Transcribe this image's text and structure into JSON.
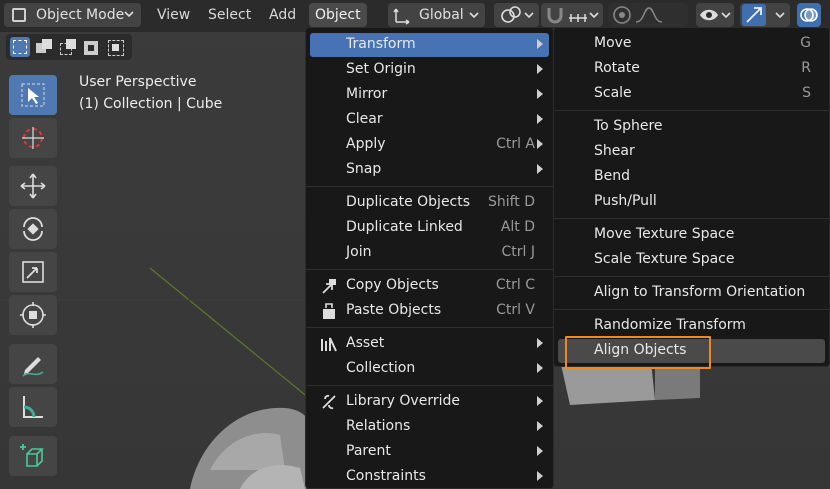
{
  "topbar": {
    "mode_label": "Object Mode",
    "menus": [
      "View",
      "Select",
      "Add",
      "Object"
    ],
    "orientation_label": "Global"
  },
  "viewport": {
    "line1": "User Perspective",
    "line2": "(1) Collection | Cube"
  },
  "object_menu": {
    "items": [
      {
        "label": "Transform",
        "submenu": true
      },
      {
        "label": "Set Origin",
        "submenu": true
      },
      {
        "label": "Mirror",
        "submenu": true
      },
      {
        "label": "Clear",
        "submenu": true
      },
      {
        "label": "Apply",
        "shortcut": "Ctrl A",
        "submenu": true
      },
      {
        "label": "Snap",
        "submenu": true
      },
      {
        "label": "Duplicate Objects",
        "shortcut": "Shift D"
      },
      {
        "label": "Duplicate Linked",
        "shortcut": "Alt D"
      },
      {
        "label": "Join",
        "shortcut": "Ctrl J"
      },
      {
        "label": "Copy Objects",
        "shortcut": "Ctrl C"
      },
      {
        "label": "Paste Objects",
        "shortcut": "Ctrl V"
      },
      {
        "label": "Asset",
        "submenu": true
      },
      {
        "label": "Collection",
        "submenu": true
      },
      {
        "label": "Library Override",
        "submenu": true
      },
      {
        "label": "Relations",
        "submenu": true
      },
      {
        "label": "Parent",
        "submenu": true
      },
      {
        "label": "Constraints",
        "submenu": true
      }
    ]
  },
  "transform_menu": {
    "items": [
      {
        "label": "Move",
        "shortcut": "G"
      },
      {
        "label": "Rotate",
        "shortcut": "R"
      },
      {
        "label": "Scale",
        "shortcut": "S"
      },
      {
        "label": "To Sphere"
      },
      {
        "label": "Shear"
      },
      {
        "label": "Bend"
      },
      {
        "label": "Push/Pull"
      },
      {
        "label": "Move Texture Space"
      },
      {
        "label": "Scale Texture Space"
      },
      {
        "label": "Align to Transform Orientation"
      },
      {
        "label": "Randomize Transform"
      },
      {
        "label": "Align Objects"
      }
    ]
  },
  "colors": {
    "highlight": "#4772b3",
    "annotation": "#f08a1c"
  }
}
